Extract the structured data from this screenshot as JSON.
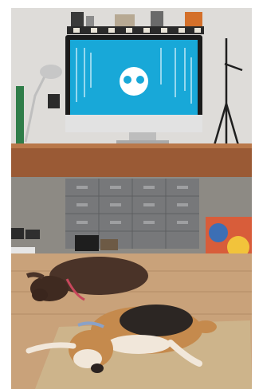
{
  "image": {
    "scene": "dogs-under-desk-with-computer",
    "palette": {
      "wall": "#dedcd9",
      "desk_wood": "#9a5a35",
      "floor_wood": "#c9a27a",
      "rug": "#cdb48b",
      "screen_blue": "#18a8d8",
      "chocolate_dog": "#4a3328",
      "beagle_tan": "#c58a4d",
      "beagle_black": "#2c2623",
      "cabinet_gray": "#77787a"
    }
  }
}
